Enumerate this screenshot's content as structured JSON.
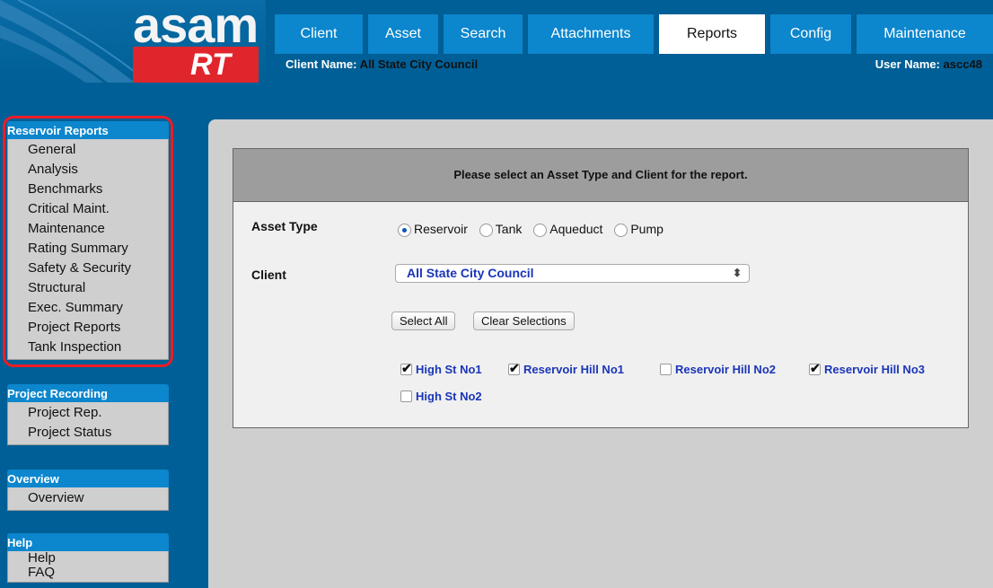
{
  "logo": {
    "word": "asam",
    "sub": "RT"
  },
  "nav": {
    "tabs": [
      {
        "label": "Client"
      },
      {
        "label": "Asset"
      },
      {
        "label": "Search"
      },
      {
        "label": "Attachments"
      },
      {
        "label": "Reports",
        "active": true
      },
      {
        "label": "Config"
      },
      {
        "label": "Maintenance"
      }
    ]
  },
  "header": {
    "client_label": "Client Name:",
    "client_value": "All State City Council",
    "user_label": "User Name:",
    "user_value": "ascc48"
  },
  "sidebar": {
    "reservoir_reports": {
      "title": "Reservoir Reports",
      "items": [
        "General",
        "Analysis",
        "Benchmarks",
        "Critical Maint.",
        "Maintenance",
        "Rating Summary",
        "Safety & Security",
        "Structural",
        "Exec. Summary",
        "Project Reports",
        "Tank Inspection"
      ]
    },
    "project_recording": {
      "title": "Project Recording",
      "items": [
        "Project Rep.",
        "Project Status"
      ]
    },
    "overview": {
      "title": "Overview",
      "items": [
        "Overview"
      ]
    },
    "help": {
      "title": "Help",
      "items": [
        "Help",
        "FAQ"
      ]
    }
  },
  "form": {
    "heading": "Please select an Asset Type and Client for the report.",
    "asset_type_label": "Asset Type",
    "asset_types": [
      {
        "label": "Reservoir",
        "selected": true
      },
      {
        "label": "Tank",
        "selected": false
      },
      {
        "label": "Aqueduct",
        "selected": false
      },
      {
        "label": "Pump",
        "selected": false
      }
    ],
    "client_label": "Client",
    "client_selected": "All State City Council",
    "select_all_label": "Select All",
    "clear_label": "Clear Selections",
    "assets": [
      {
        "label": "High St No1",
        "checked": true
      },
      {
        "label": "Reservoir Hill No1",
        "checked": true
      },
      {
        "label": "Reservoir Hill No2",
        "checked": false
      },
      {
        "label": "Reservoir Hill No3",
        "checked": true
      },
      {
        "label": "High St No2",
        "checked": false
      }
    ]
  },
  "colors": {
    "background": "#005f96",
    "tab_blue": "#0c86cd",
    "highlight_red": "#ee1c24",
    "link_blue": "#1a35b8"
  }
}
